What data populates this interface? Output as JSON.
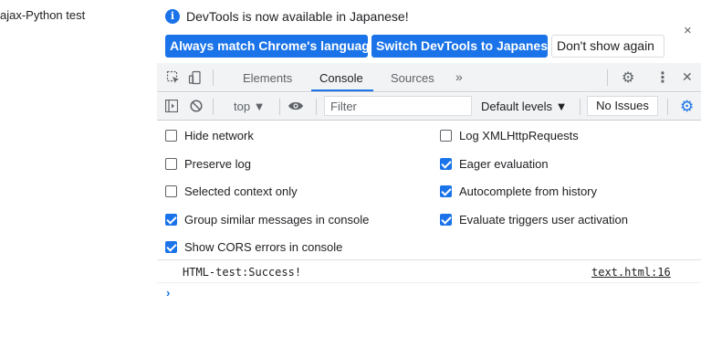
{
  "page": {
    "text": "ajax-Python test"
  },
  "infobar": {
    "message": "DevTools is now available in Japanese!",
    "info_icon": "i",
    "close": "×",
    "buttons": {
      "match": "Always match Chrome's language",
      "switch": "Switch DevTools to Japanese",
      "dont_show": "Don't show again"
    }
  },
  "tabs": {
    "items": [
      "Elements",
      "Console",
      "Sources"
    ],
    "active": "Console",
    "more": "»",
    "gear": "⚙",
    "kebab": "⋮",
    "close": "✕"
  },
  "console_toolbar": {
    "context": "top ▼",
    "filter_placeholder": "Filter",
    "levels": "Default levels ▼",
    "issues": "No Issues",
    "gear": "⚙"
  },
  "settings": {
    "left": [
      {
        "label": "Hide network",
        "checked": false
      },
      {
        "label": "Preserve log",
        "checked": false
      },
      {
        "label": "Selected context only",
        "checked": false
      },
      {
        "label": "Group similar messages in console",
        "checked": true
      },
      {
        "label": "Show CORS errors in console",
        "checked": true
      }
    ],
    "right": [
      {
        "label": "Log XMLHttpRequests",
        "checked": false
      },
      {
        "label": "Eager evaluation",
        "checked": true
      },
      {
        "label": "Autocomplete from history",
        "checked": true
      },
      {
        "label": "Evaluate triggers user activation",
        "checked": true
      }
    ]
  },
  "console": {
    "message": "HTML-test:Success!",
    "source": "text.html:16",
    "prompt": "›"
  },
  "colors": {
    "accent": "#1a73e8",
    "toolbar_bg": "#f1f3f4"
  }
}
